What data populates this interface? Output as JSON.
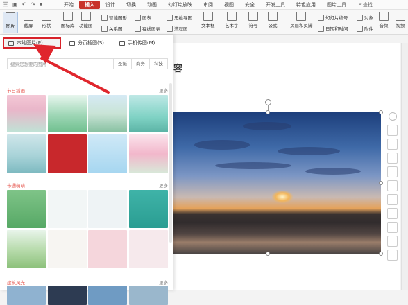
{
  "menubar": {
    "file_label": "三",
    "tabs": [
      {
        "label": "开始"
      },
      {
        "label": "插入"
      },
      {
        "label": "设计"
      },
      {
        "label": "切换"
      },
      {
        "label": "动画"
      },
      {
        "label": "幻灯片放映"
      },
      {
        "label": "审阅"
      },
      {
        "label": "视图"
      },
      {
        "label": "安全"
      },
      {
        "label": "开发工具"
      },
      {
        "label": "特色应用"
      },
      {
        "label": "图片工具"
      }
    ],
    "search_label": "查找"
  },
  "ribbon": {
    "picture": "图片",
    "screenshot": "截屏",
    "shape": "形状",
    "gallery": "图标库",
    "function_chart": "功能图",
    "smart_shape": "智能图形",
    "chart": "图表",
    "mind_map": "思维导图",
    "relation": "关系图",
    "online_chart": "在线图表",
    "flowchart": "流程图",
    "textbox": "文本框",
    "art_text": "艺术字",
    "symbol": "符号",
    "formula": "公式",
    "header_footer": "页眉和页脚",
    "slide_number": "幻灯片编号",
    "object": "对象",
    "date_time": "日期和时间",
    "attachment": "附件",
    "audio": "音频",
    "video": "视频"
  },
  "panel": {
    "local_picture": "本地图片(P)",
    "paged_insert": "分页插图(S)",
    "phone_picture": "手机传图(M)",
    "search_placeholder": "搜索您想要的图片",
    "tags": [
      "圣诞",
      "商务",
      "科技"
    ],
    "sections": [
      {
        "title": "节日插画",
        "more": "更多"
      },
      {
        "title": "卡通萌萌",
        "more": "更多"
      },
      {
        "title": "建筑风光",
        "more": "更多"
      }
    ]
  },
  "slide": {
    "title": "容"
  },
  "colors": {
    "accent": "#c8322a",
    "highlight_box": "#d8222a",
    "section_title": "#e5534b"
  }
}
